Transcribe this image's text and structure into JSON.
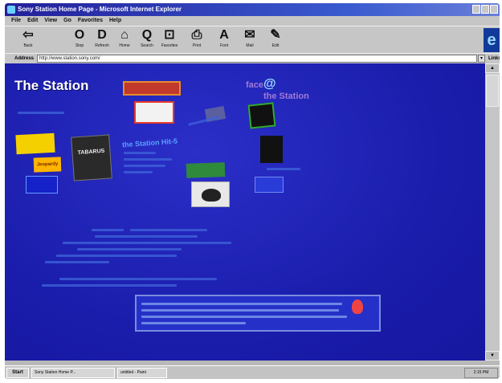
{
  "window": {
    "title": "Sony Station Home Page - Microsoft Internet Explorer"
  },
  "menu": [
    "File",
    "Edit",
    "View",
    "Go",
    "Favorites",
    "Help"
  ],
  "toolbar": [
    {
      "label": "Back",
      "glyph": "⇦"
    },
    {
      "label": "Stop",
      "glyph": "O"
    },
    {
      "label": "Refresh",
      "glyph": "D"
    },
    {
      "label": "Home",
      "glyph": "⌂"
    },
    {
      "label": "Search",
      "glyph": "Q"
    },
    {
      "label": "Favorites",
      "glyph": "⊡"
    },
    {
      "label": "Print",
      "glyph": "⎙"
    },
    {
      "label": "Font",
      "glyph": "A"
    },
    {
      "label": "Mail",
      "glyph": "✉"
    },
    {
      "label": "Edit",
      "glyph": "✎"
    }
  ],
  "address": {
    "label": "Address",
    "url": "http://www.station.sony.com/",
    "links_label": "Links"
  },
  "page": {
    "logo": "The Station",
    "headline": "the Station Hit-5",
    "logo2_prefix": "face",
    "logo2_at": "@",
    "logo2_suffix": "the Station",
    "card_dark": "TABARUS",
    "card_yellow": "Jeopardy"
  },
  "taskbar": {
    "start": "Start",
    "task1": "Sony Station Home P...",
    "task2": "untitled - Paint",
    "clock": "2:15 PM"
  }
}
